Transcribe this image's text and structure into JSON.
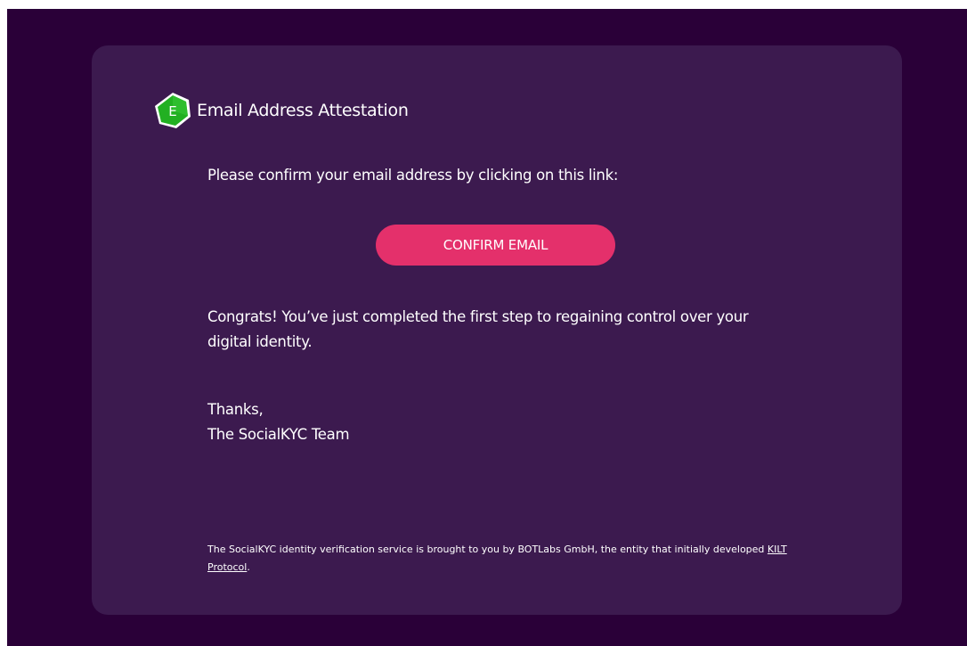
{
  "header": {
    "logo_letter": "E",
    "title": "Email Address Attestation"
  },
  "body": {
    "intro": "Please confirm your email address by clicking on this link:",
    "confirm_button": "CONFIRM EMAIL",
    "congrats": "Congrats! You’ve just completed the first step to regaining control over your digital identity.",
    "thanks": "Thanks,",
    "team": "The SocialKYC Team"
  },
  "footer": {
    "text_before_link": "The SocialKYC identity verification service is brought to you by BOTLabs GmbH, the entity that initially developed ",
    "link_text": "KILT Protocol",
    "text_after_link": "."
  },
  "colors": {
    "page_background": "#2a0038",
    "card_background": "#3c1a4f",
    "button": "#e4306b",
    "logo_green": "#22b022"
  },
  "icons": {
    "logo": "email-attestation-hexagon-icon"
  }
}
